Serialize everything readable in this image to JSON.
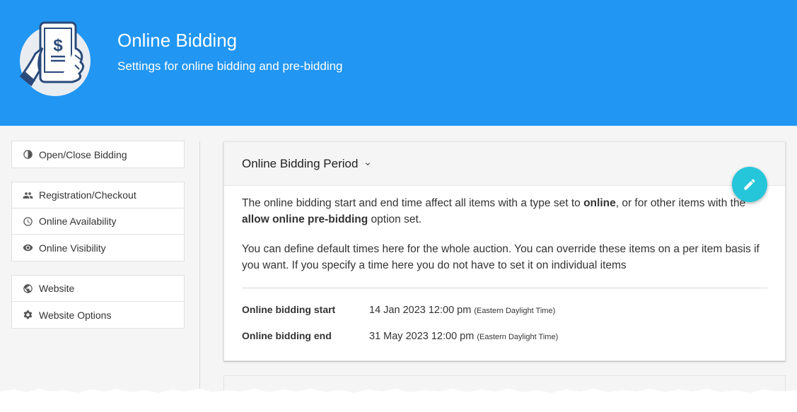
{
  "header": {
    "title": "Online Bidding",
    "subtitle": "Settings for online bidding and pre-bidding",
    "background_color": "#2196f3",
    "logo_icon": "phone-dollar-hand-icon"
  },
  "sidebar": {
    "groups": [
      {
        "items": [
          {
            "icon": "contrast-icon",
            "label": "Open/Close Bidding"
          }
        ]
      },
      {
        "items": [
          {
            "icon": "people-icon",
            "label": "Registration/Checkout"
          },
          {
            "icon": "clock-icon",
            "label": "Online Availability"
          },
          {
            "icon": "eye-icon",
            "label": "Online Visibility"
          }
        ]
      },
      {
        "items": [
          {
            "icon": "globe-icon",
            "label": "Website"
          },
          {
            "icon": "gear-icon",
            "label": "Website Options"
          }
        ]
      }
    ]
  },
  "card": {
    "title": "Online Bidding Period",
    "edit_icon": "pencil-icon",
    "edit_button_color": "#26c6da",
    "para1": {
      "t1": "The online bidding start and end time affect all items with a type set to ",
      "b1": "online",
      "t2": ", or for other items with the ",
      "b2": "allow online pre-bidding",
      "t3": " option set."
    },
    "para2": "You can define default times here for the whole auction. You can override these items on a per item basis if you want. If you specify a time here you do not have to set it on individual items",
    "rows": [
      {
        "label": "Online bidding start",
        "value": "14 Jan 2023 12:00 pm",
        "tz": "(Eastern Daylight Time)"
      },
      {
        "label": "Online bidding end",
        "value": "31 May 2023 12:00 pm",
        "tz": "(Eastern Daylight Time)"
      }
    ]
  }
}
